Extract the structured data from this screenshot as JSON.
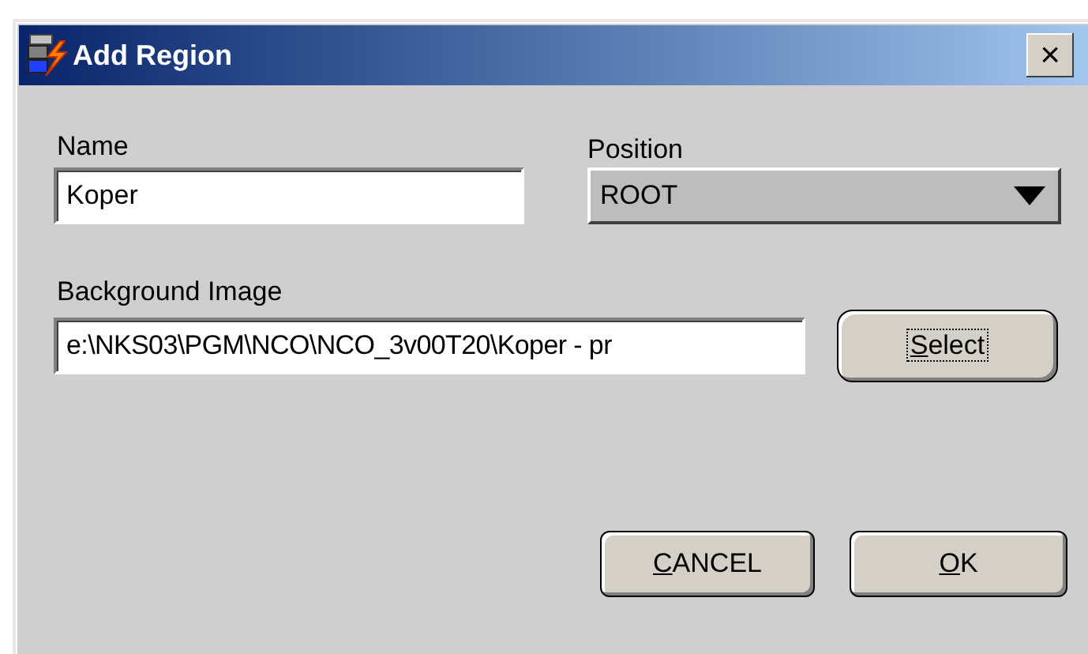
{
  "window": {
    "title": "Add Region",
    "close_label": "×"
  },
  "name_field": {
    "label": "Name",
    "value": "Koper"
  },
  "position_field": {
    "label": "Position",
    "value": "ROOT"
  },
  "background_field": {
    "label": "Background Image",
    "value": "e:\\NKS03\\PGM\\NCO\\NCO_3v00T20\\Koper - pr"
  },
  "buttons": [
    {
      "label": "Select",
      "access_key_underlined": true,
      "focused": true
    },
    {
      "label": "CANCEL",
      "access_key_underlined": true,
      "focused": false
    },
    {
      "label": "OK",
      "access_key_underlined": true,
      "focused": false
    }
  ]
}
